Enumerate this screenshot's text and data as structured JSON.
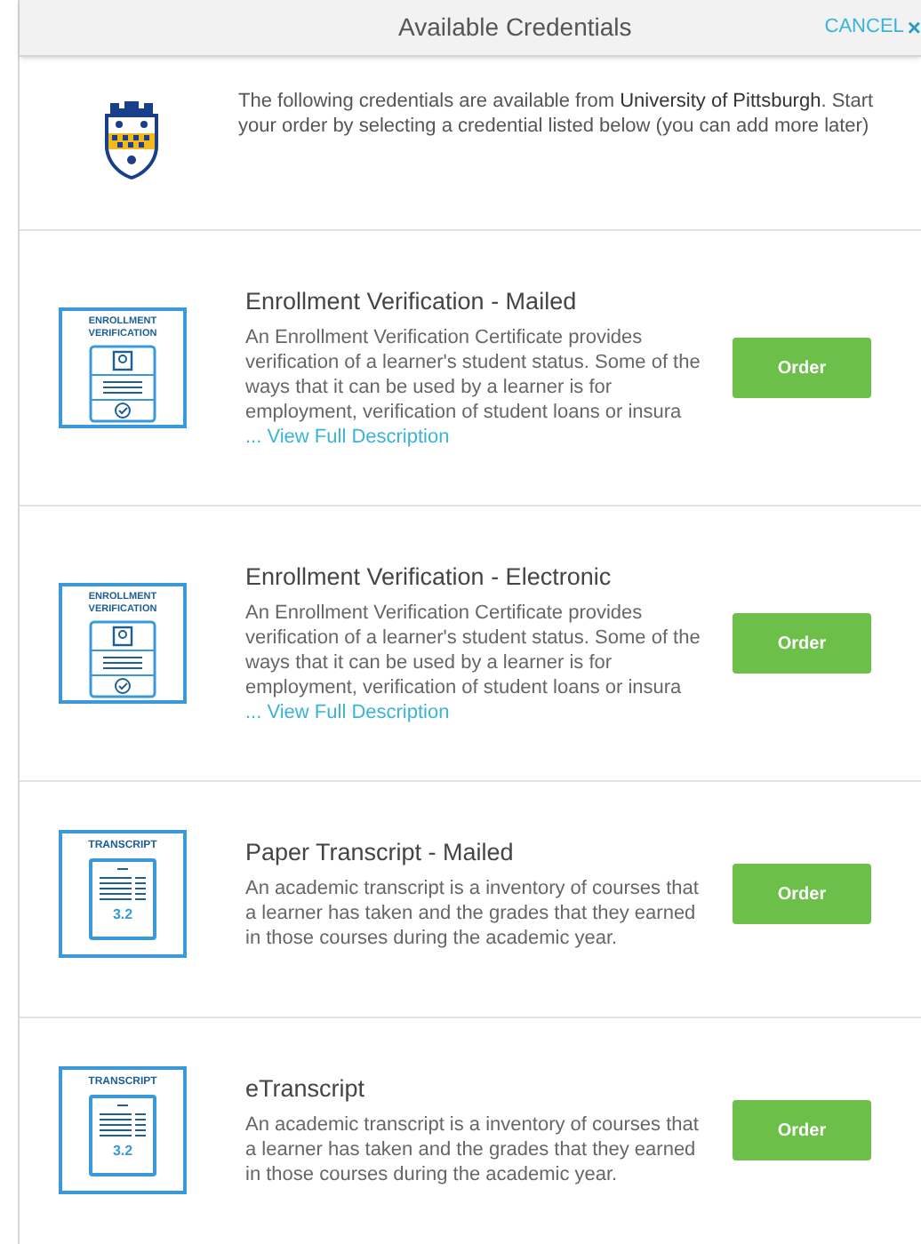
{
  "header": {
    "title": "Available Credentials",
    "cancel": "CANCEL",
    "close_glyph": "×"
  },
  "intro": {
    "text": "The following credentials are available from **University of Pittsburgh**. Start your order by selecting a credential listed below (you can add more later)"
  },
  "credentials": [
    {
      "kind": "enrollment",
      "icon_label": "ENROLLMENT VERIFICATION",
      "title": "Enrollment Verification - Mailed",
      "description": "An Enrollment Verification Certificate provides verification of a learner's student status. Some of the ways that it can be used by a learner is for employment, verification of student loans or insura",
      "more_link": "... View Full Description",
      "button": "Order"
    },
    {
      "kind": "enrollment",
      "icon_label": "ENROLLMENT VERIFICATION",
      "title": "Enrollment Verification - Electronic",
      "description": "An Enrollment Verification Certificate provides verification of a learner's student status. Some of the ways that it can be used by a learner is for employment, verification of student loans or insura",
      "more_link": "... View Full Description",
      "button": "Order"
    },
    {
      "kind": "transcript",
      "icon_label": "TRANSCRIPT",
      "grade": "3.2",
      "title": "Paper Transcript - Mailed",
      "description": "An academic transcript is a inventory of courses that a learner has taken and the grades that they earned in those courses during the academic year.",
      "button": "Order"
    },
    {
      "kind": "transcript",
      "icon_label": "TRANSCRIPT",
      "grade": "3.2",
      "title": "eTranscript",
      "description": "An academic transcript is a inventory of courses that a learner has taken and the grades that they earned in those courses during the academic year.",
      "button": "Order"
    }
  ]
}
